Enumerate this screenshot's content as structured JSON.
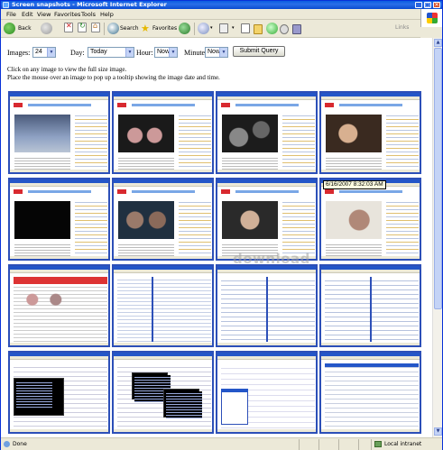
{
  "window": {
    "title": "Screen snapshots - Microsoft Internet Explorer"
  },
  "menu": [
    "File",
    "Edit",
    "View",
    "Favorites",
    "Tools",
    "Help"
  ],
  "toolbar": {
    "back_label": "Back",
    "search_label": "Search",
    "favorites_label": "Favorites",
    "links_label": "Links"
  },
  "form": {
    "images_label": "Images:",
    "images_value": "24",
    "day_label": "Day:",
    "day_value": "Today",
    "hour_label": "Hour:",
    "hour_value": "Now",
    "minute_label": "Minute:",
    "minute_value": "Now",
    "submit_label": "Submit Query"
  },
  "help": {
    "line1": "Click on any image to view the full size image.",
    "line2": "Place the mouse over an image to pop up a tooltip showing the image date and time."
  },
  "tooltip": "6/16/2007 8:32:03 AM",
  "watermark": "download",
  "status": {
    "left": "Done",
    "zone": "Local intranet"
  },
  "colors": {
    "title_bar": "#0a5ce0",
    "thumbnail_border": "#2c4fb8",
    "tooltip_bg": "#ffffe1"
  }
}
